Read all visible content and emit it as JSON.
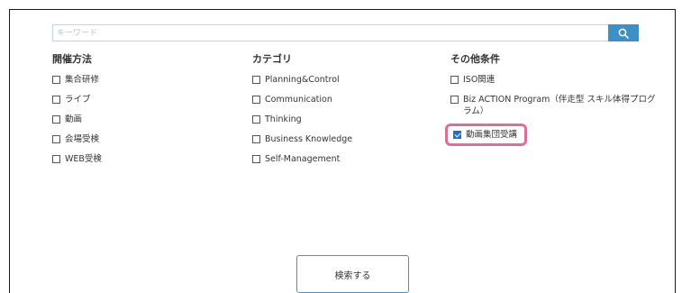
{
  "search": {
    "placeholder": "キーワード",
    "value": "",
    "button_icon": "search-icon"
  },
  "columns": [
    {
      "heading": "開催方法",
      "options": [
        {
          "label": "集合研修",
          "checked": false
        },
        {
          "label": "ライブ",
          "checked": false
        },
        {
          "label": "動画",
          "checked": false
        },
        {
          "label": "会場受検",
          "checked": false
        },
        {
          "label": "WEB受検",
          "checked": false
        }
      ]
    },
    {
      "heading": "カテゴリ",
      "options": [
        {
          "label": "Planning&Control",
          "checked": false
        },
        {
          "label": "Communication",
          "checked": false
        },
        {
          "label": "Thinking",
          "checked": false
        },
        {
          "label": "Business Knowledge",
          "checked": false
        },
        {
          "label": "Self-Management",
          "checked": false
        }
      ]
    },
    {
      "heading": "その他条件",
      "options": [
        {
          "label": "ISO関連",
          "checked": false
        },
        {
          "label": "Biz ACTION Program（伴走型 スキル体得プログラム）",
          "checked": false
        },
        {
          "label": "動画集団受講",
          "checked": true,
          "highlighted": true
        }
      ]
    }
  ],
  "submit": {
    "label": "検索する"
  },
  "colors": {
    "accent": "#3d8fc6",
    "highlight_border": "#d8709a",
    "checkbox_checked": "#1f6fd1"
  }
}
